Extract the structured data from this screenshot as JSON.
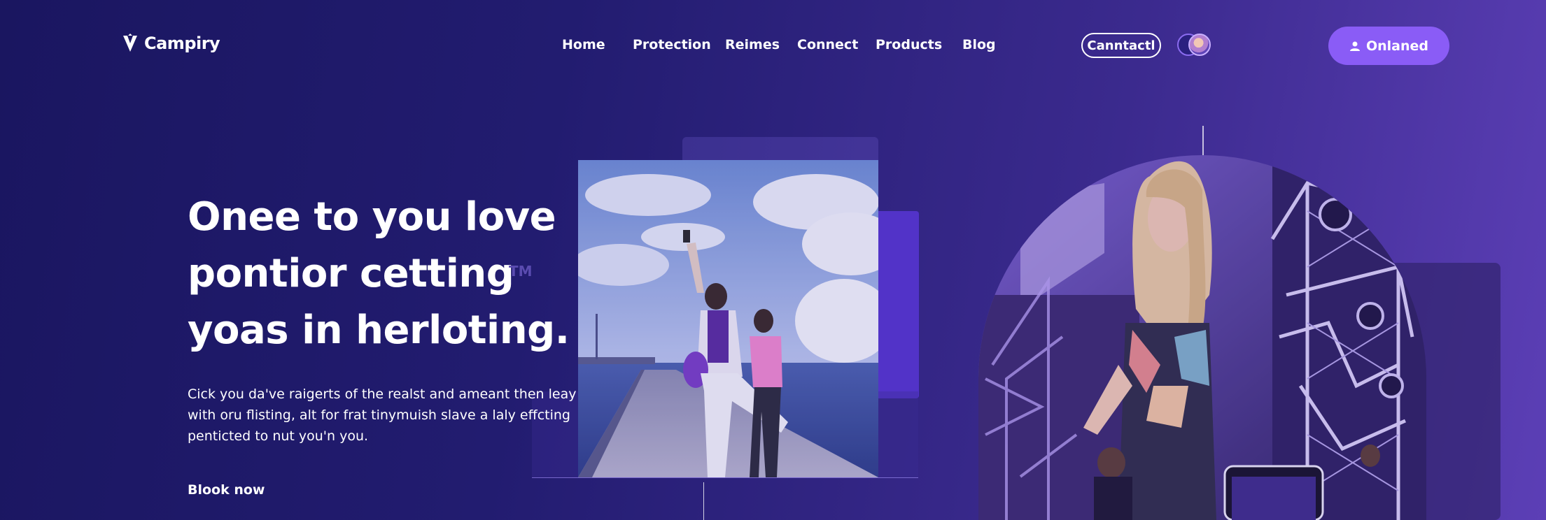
{
  "brand": {
    "name": "Campiry",
    "logo_icon": "v-shield-icon"
  },
  "nav": {
    "items": [
      {
        "label": "Home"
      },
      {
        "label": "Protection"
      },
      {
        "label": "Reimes"
      },
      {
        "label": "Connect"
      },
      {
        "label": "Products"
      },
      {
        "label": "Blog"
      }
    ],
    "contact_label": "Canntactl",
    "signin_label": "Onlaned",
    "signin_icon": "user-icon"
  },
  "hero": {
    "title_lines": [
      "Onee to you love",
      "pontior cetting",
      "yoas in herloting."
    ],
    "tm": "TM",
    "text_lines": [
      "Cick you da've raigerts of the realst and ameant then leay",
      "with oru flisting, alt for frat tinymuish slave a laly effcting",
      "penticted to nut you'n you."
    ],
    "cta_label": "Blook now"
  },
  "colors": {
    "bg_start": "#1a1660",
    "bg_end": "#5c3fb6",
    "accent": "#8a5cf6"
  }
}
